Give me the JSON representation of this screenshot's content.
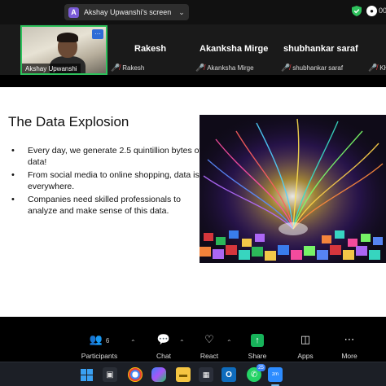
{
  "top_bar": {
    "share_badge": "A",
    "share_title": "Akshay Upwanshi's screen",
    "share_chevron": "chevron-down-icon",
    "shield_icon": "shield-check-icon",
    "time_text": "00:"
  },
  "participants": {
    "video_tile": {
      "name": "Akshay Upwanshi",
      "more_label": "···"
    },
    "tiles": [
      {
        "name": "Rakesh",
        "sub": "Rakesh"
      },
      {
        "name": "Akanksha Mirge",
        "sub": "Akanksha Mirge"
      },
      {
        "name": "shubhankar saraf",
        "sub": "shubhankar saraf"
      },
      {
        "name": "",
        "sub": "KH"
      }
    ]
  },
  "slide": {
    "title": "The Data Explosion",
    "bullets": [
      "Every day, we generate 2.5 quintillion bytes of data!",
      "From social media to online shopping, data is everywhere.",
      "Companies need skilled professionals to analyze and make sense of this data."
    ]
  },
  "toolbar": {
    "participants_label": "Participants",
    "participants_count": "6",
    "chat_label": "Chat",
    "react_label": "React",
    "share_label": "Share",
    "apps_label": "Apps",
    "more_label": "More"
  },
  "taskbar": {
    "whatsapp_badge": "25"
  },
  "colors": {
    "speaking_border": "#2ec15c",
    "share_green": "#17b35a",
    "mic_off_red": "#e0393e",
    "accent_purple": "#7a5bd6"
  }
}
